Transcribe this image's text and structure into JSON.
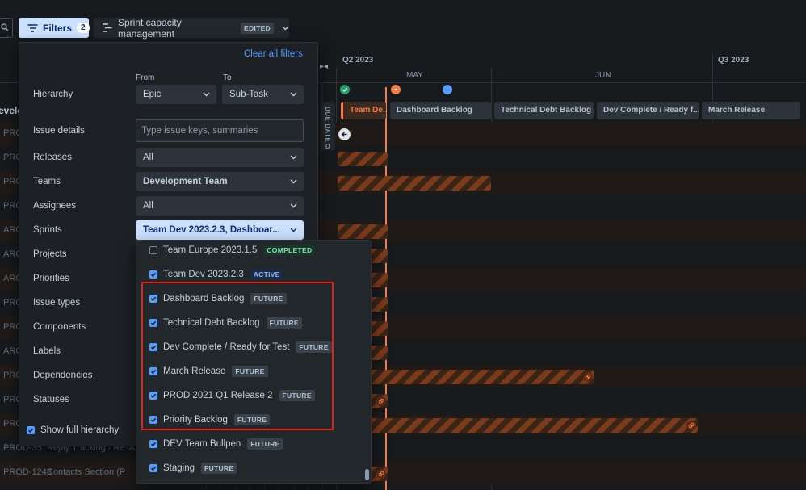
{
  "toolbar": {
    "filters_label": "Filters",
    "filters_count": "2",
    "view_name": "Sprint capacity management",
    "view_state": "EDITED"
  },
  "timeline": {
    "quarters": [
      "Q2 2023",
      "Q3 2023"
    ],
    "months": [
      "MAY",
      "JUN"
    ],
    "due_date_label": "DUE DATE",
    "due_col_letter": "D",
    "sprint_chips": [
      "Team De...",
      "Dashboard Backlog",
      "Technical Debt Backlog",
      "Dev Complete / Ready f...",
      "March Release"
    ],
    "rows": [
      {
        "id": "PRO",
        "title": ""
      },
      {
        "id": "PRO",
        "title": ""
      },
      {
        "id": "PRO",
        "title": ""
      },
      {
        "id": "PRO",
        "title": ""
      },
      {
        "id": "ARC",
        "title": ""
      },
      {
        "id": "ARC",
        "title": ""
      },
      {
        "id": "ARC",
        "title": ""
      },
      {
        "id": "PRO",
        "title": ""
      },
      {
        "id": "PRO",
        "title": ""
      },
      {
        "id": "ARC",
        "title": ""
      },
      {
        "id": "PRO",
        "title": ""
      },
      {
        "id": "PRO",
        "title": ""
      },
      {
        "id": "PRO",
        "title": ""
      },
      {
        "id": "PROD-35",
        "title": "Reply Tracking - RE-A"
      },
      {
        "id": "PROD-1243",
        "title": "Contacts Section (P"
      }
    ],
    "left_header_fragment": "evelo"
  },
  "filter_panel": {
    "clear_all": "Clear all filters",
    "from_label": "From",
    "to_label": "To",
    "hierarchy_label": "Hierarchy",
    "hierarchy_from": "Epic",
    "hierarchy_to": "Sub-Task",
    "issue_details_label": "Issue details",
    "issue_details_placeholder": "Type issue keys, summaries",
    "releases_label": "Releases",
    "releases_value": "All",
    "teams_label": "Teams",
    "teams_value": "Development Team",
    "assignees_label": "Assignees",
    "assignees_value": "All",
    "sprints_label": "Sprints",
    "sprints_value": "Team Dev 2023.2.3, Dashboar...",
    "projects_label": "Projects",
    "priorities_label": "Priorities",
    "issue_types_label": "Issue types",
    "components_label": "Components",
    "labels_label": "Labels",
    "dependencies_label": "Dependencies",
    "statuses_label": "Statuses",
    "show_full_hierarchy": "Show full hierarchy"
  },
  "sprint_options": [
    {
      "name": "Team Europe 2023.1.5",
      "state": "COMPLETED",
      "checked": false
    },
    {
      "name": "Team Dev 2023.2.3",
      "state": "ACTIVE",
      "checked": true
    },
    {
      "name": "Dashboard Backlog",
      "state": "FUTURE",
      "checked": true
    },
    {
      "name": "Technical Debt Backlog",
      "state": "FUTURE",
      "checked": true
    },
    {
      "name": "Dev Complete / Ready for Test",
      "state": "FUTURE",
      "checked": true
    },
    {
      "name": "March Release",
      "state": "FUTURE",
      "checked": true
    },
    {
      "name": "PROD 2021 Q1 Release 2",
      "state": "FUTURE",
      "checked": true
    },
    {
      "name": "Priority Backlog",
      "state": "FUTURE",
      "checked": true
    },
    {
      "name": "DEV Team Bullpen",
      "state": "FUTURE",
      "checked": true
    },
    {
      "name": "Staging",
      "state": "FUTURE",
      "checked": true
    }
  ],
  "colors": {
    "accent": "#579dff",
    "today_line": "#f87c48",
    "highlight_box": "#e2231a"
  }
}
